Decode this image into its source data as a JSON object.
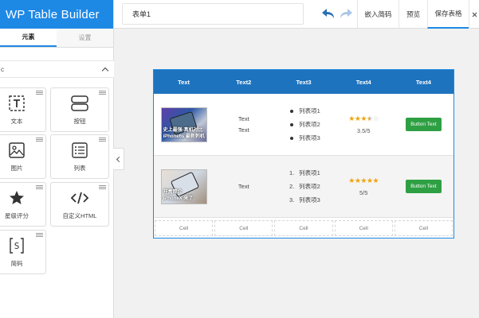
{
  "app": {
    "brand": "WP Table Builder"
  },
  "sidebar": {
    "tabs": [
      {
        "label": "元素",
        "active": true
      },
      {
        "label": "设置",
        "active": false
      }
    ],
    "section_title": "c",
    "elements": [
      {
        "label": "文本",
        "icon": "text-icon"
      },
      {
        "label": "按钮",
        "icon": "button-icon"
      },
      {
        "label": "图片",
        "icon": "image-icon"
      },
      {
        "label": "列表",
        "icon": "list-icon"
      },
      {
        "label": "星级评分",
        "icon": "star-icon"
      },
      {
        "label": "自定义HTML",
        "icon": "code-icon"
      },
      {
        "label": "简码",
        "icon": "shortcode-icon"
      }
    ]
  },
  "toolbar": {
    "table_title": "表单1",
    "embed_label": "嵌入简码",
    "preview_label": "预览",
    "save_label": "保存表格"
  },
  "table": {
    "headers": [
      "Text",
      "Text2",
      "Text3",
      "Text4",
      "Text4"
    ],
    "row1": {
      "image_caption_top": "史上最强·真机对比",
      "image_caption": "iPhone6s 最新刺机",
      "text_lines": [
        "Text",
        "Text"
      ],
      "list_items": [
        "列表项1",
        "列表项2",
        "列表项3"
      ],
      "rating": 3.5,
      "rating_label": "3.5/5",
      "button_label": "Button Text"
    },
    "row2": {
      "image_caption_top": "开盒简介",
      "image_caption": "iPhoneX 来了",
      "text": "Text",
      "list_items": [
        "列表项1",
        "列表项2",
        "列表项3"
      ],
      "list_markers": [
        "1.",
        "2.",
        "3."
      ],
      "rating": 5,
      "rating_label": "5/5",
      "button_label": "Button Text"
    },
    "empty_cells": [
      "Cell",
      "Cell",
      "Cell",
      "Cell",
      "Cell"
    ]
  },
  "colors": {
    "accent": "#1e88e5",
    "header_bg": "#1e73be",
    "button_green": "#2ea043",
    "star": "#f0a30a"
  }
}
